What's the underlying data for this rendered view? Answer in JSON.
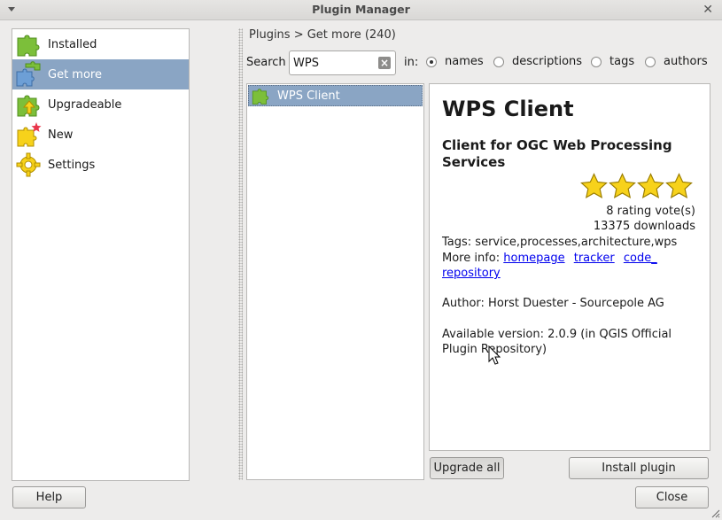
{
  "window": {
    "title": "Plugin Manager"
  },
  "categories": [
    {
      "label": "Installed",
      "icon": "puzzle-green-icon"
    },
    {
      "label": "Get more",
      "icon": "puzzle-blue-icon"
    },
    {
      "label": "Upgradeable",
      "icon": "puzzle-upgrade-icon"
    },
    {
      "label": "New",
      "icon": "puzzle-new-icon"
    },
    {
      "label": "Settings",
      "icon": "gear-icon"
    }
  ],
  "breadcrumb": "Plugins > Get more (240)",
  "search": {
    "label": "Search",
    "value": "WPS",
    "in_label": "in:",
    "options": [
      {
        "label": "names",
        "checked": true
      },
      {
        "label": "descriptions",
        "checked": false
      },
      {
        "label": "tags",
        "checked": false
      },
      {
        "label": "authors",
        "checked": false
      }
    ]
  },
  "plugins": [
    {
      "name": "WPS Client"
    }
  ],
  "details": {
    "name": "WPS Client",
    "description": "Client for OGC Web Processing Services",
    "rating_stars": 4,
    "votes": "8 rating vote(s)",
    "downloads": "13375 downloads",
    "tags": "Tags: service,processes,architecture,wps",
    "more_info_label": "More info:",
    "links": [
      "homepage",
      "tracker",
      "code_ repository"
    ],
    "author": "Author: Horst Duester - Sourcepole AG",
    "version": "Available version: 2.0.9 (in QGIS Official Plugin Repository)"
  },
  "buttons": {
    "upgrade_all": "Upgrade all",
    "install": "Install plugin",
    "help": "Help",
    "close": "Close"
  },
  "colors": {
    "selection": "#8aa5c4",
    "star": "#f7d21b",
    "link": "#0000ee"
  }
}
